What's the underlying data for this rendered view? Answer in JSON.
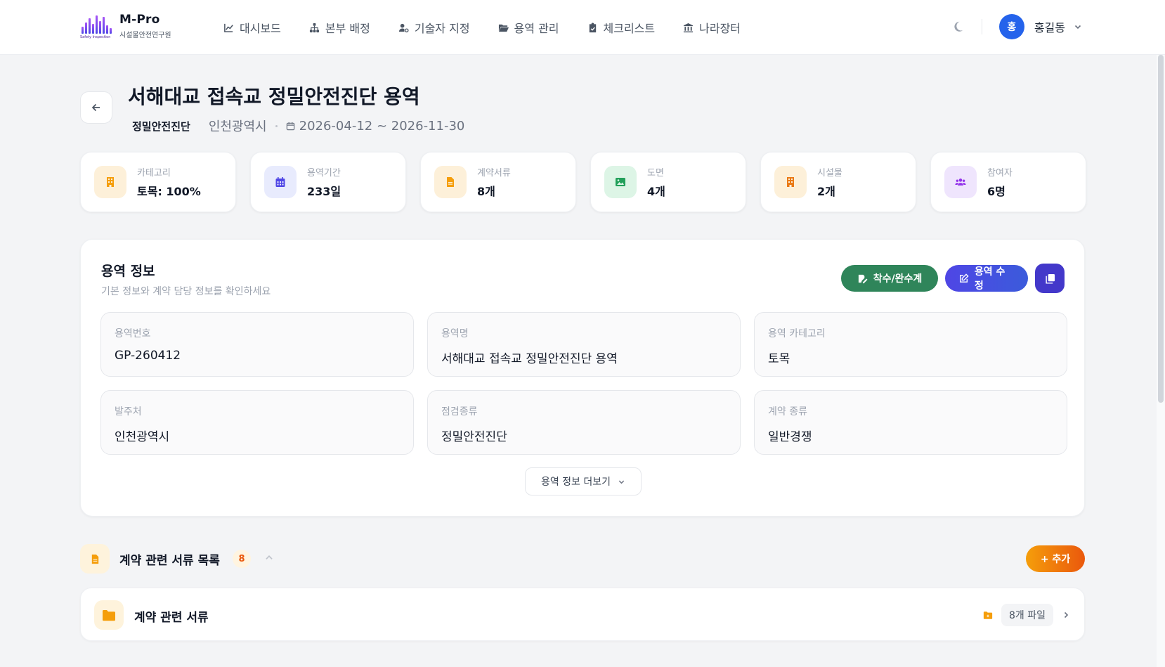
{
  "brand": {
    "title": "M-Pro",
    "caption": "시설물안전연구원",
    "mark_text": "Safety Inspection"
  },
  "nav": [
    {
      "label": "대시보드",
      "icon": "chart-line-icon"
    },
    {
      "label": "본부 배정",
      "icon": "sitemap-icon"
    },
    {
      "label": "기술자 지정",
      "icon": "user-gear-icon"
    },
    {
      "label": "용역 관리",
      "icon": "folder-open-icon"
    },
    {
      "label": "체크리스트",
      "icon": "clipboard-check-icon"
    },
    {
      "label": "나라장터",
      "icon": "landmark-icon"
    }
  ],
  "user": {
    "avatar_initial": "홍",
    "name": "홍길동"
  },
  "project": {
    "title": "서해대교 접속교 정밀안전진단 용역",
    "type": "정밀안전진단",
    "client": "인천광역시",
    "period": "2026-04-12 ~ 2026-11-30"
  },
  "stats": [
    {
      "label": "카테고리",
      "value": "토목: 100%",
      "icon": "building-icon",
      "bg": "#fdf0d9",
      "fg": "#f59e0b"
    },
    {
      "label": "용역기간",
      "value": "233일",
      "icon": "calendar-icon",
      "bg": "#e8ebfd",
      "fg": "#4f46e5"
    },
    {
      "label": "계약서류",
      "value": "8개",
      "icon": "file-icon",
      "bg": "#fdf0d9",
      "fg": "#f59e0b"
    },
    {
      "label": "도면",
      "value": "4개",
      "icon": "image-icon",
      "bg": "#ddf5e6",
      "fg": "#22a05a"
    },
    {
      "label": "시설물",
      "value": "2개",
      "icon": "building-icon",
      "bg": "#fdf0d9",
      "fg": "#ea7a17"
    },
    {
      "label": "참여자",
      "value": "6명",
      "icon": "users-icon",
      "bg": "#efe5fd",
      "fg": "#9333ea"
    }
  ],
  "info": {
    "title": "용역 정보",
    "description": "기본 정보와 계약 담당 정보를 확인하세요",
    "start_complete_label": "착수/완수계",
    "edit_label": "용역 수정",
    "more_label": "용역 정보 더보기",
    "fields": [
      {
        "label": "용역번호",
        "value": "GP-260412"
      },
      {
        "label": "용역명",
        "value": "서해대교 접속교 정밀안전진단 용역"
      },
      {
        "label": "용역 카테고리",
        "value": "토목"
      },
      {
        "label": "발주처",
        "value": "인천광역시"
      },
      {
        "label": "점검종류",
        "value": "정밀안전진단"
      },
      {
        "label": "계약 종류",
        "value": "일반경쟁"
      }
    ]
  },
  "documents": {
    "title": "계약 관련 서류 목록",
    "count": "8",
    "add_label": "+ 추가",
    "folder_name": "계약 관련 서류",
    "file_count": "8개 파일"
  },
  "colors": {
    "primary": "#4f46e5",
    "green": "#2f855a",
    "orange": "#ea580c",
    "avatar": "#2563eb"
  }
}
